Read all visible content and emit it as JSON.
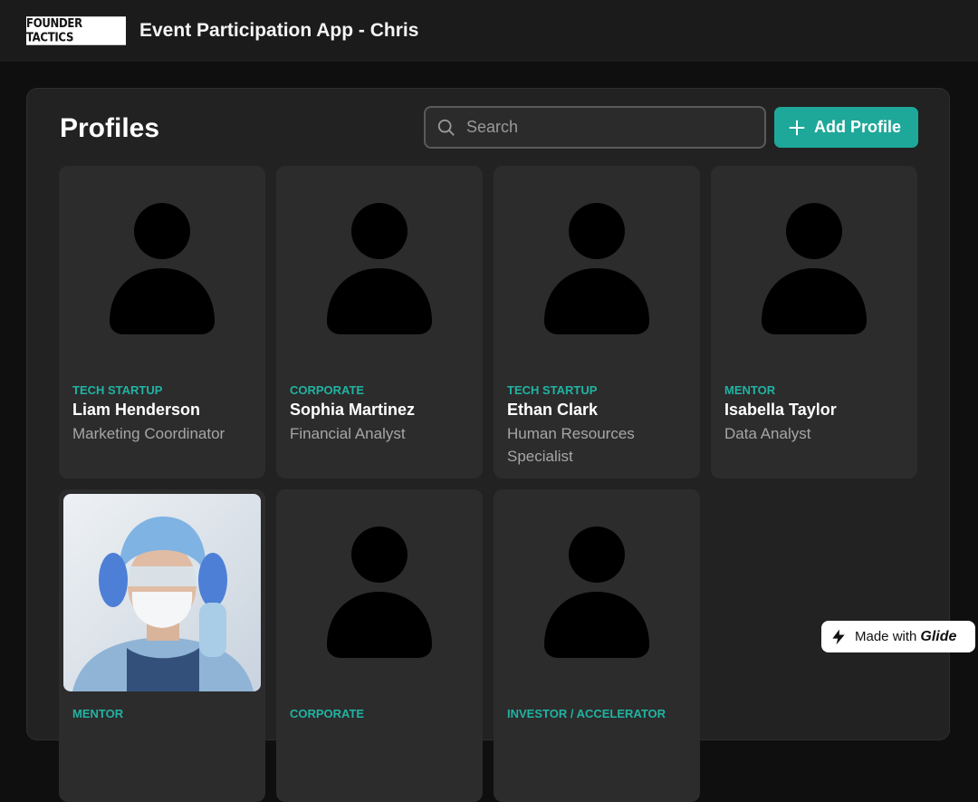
{
  "header": {
    "logo_text": "FOUNDER TACTICS",
    "app_title": "Event Participation App - Chris"
  },
  "page": {
    "title": "Profiles",
    "search_placeholder": "Search",
    "add_button_label": "Add Profile"
  },
  "profiles": [
    {
      "category": "TECH STARTUP",
      "name": "Liam Henderson",
      "role": "Marketing Coordinator",
      "avatar": "person-placeholder-icon"
    },
    {
      "category": "CORPORATE",
      "name": "Sophia Martinez",
      "role": "Financial Analyst",
      "avatar": "person-placeholder-icon"
    },
    {
      "category": "TECH STARTUP",
      "name": "Ethan Clark",
      "role": "Human Resources Specialist",
      "avatar": "person-placeholder-icon"
    },
    {
      "category": "MENTOR",
      "name": "Isabella Taylor",
      "role": "Data Analyst",
      "avatar": "person-placeholder-icon"
    },
    {
      "category": "MENTOR",
      "name": "",
      "role": "",
      "avatar": "profile-photo"
    },
    {
      "category": "CORPORATE",
      "name": "",
      "role": "",
      "avatar": "person-placeholder-icon"
    },
    {
      "category": "INVESTOR / ACCELERATOR",
      "name": "",
      "role": "",
      "avatar": "person-placeholder-icon"
    }
  ],
  "badge": {
    "prefix": "Made with",
    "brand": "Glide"
  },
  "colors": {
    "accent": "#1ea89a",
    "category_text": "#21b3a2",
    "background": "#0f0f0f",
    "card": "#2c2c2c"
  }
}
